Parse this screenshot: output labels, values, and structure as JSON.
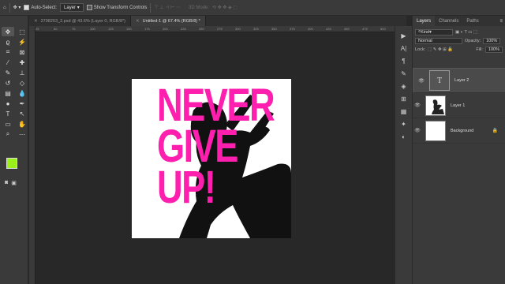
{
  "options_bar": {
    "home_icon": "home-icon",
    "move_icon": "move-icon",
    "auto_select_label": "Auto-Select:",
    "auto_select_value": "Layer",
    "show_transform_label": "Show Transform Controls",
    "threed_mode_label": "3D Mode:"
  },
  "tabs": [
    {
      "label": "2798203_2.psd @ 43.6% (Layer 0, RGB/8*)",
      "active": false
    },
    {
      "label": "Untitled-1 @ 67.4% (RGB/8) *",
      "active": true
    }
  ],
  "ruler_ticks": [
    "25",
    "50",
    "75",
    "100",
    "125",
    "150",
    "175",
    "200",
    "225",
    "250",
    "275",
    "300",
    "325",
    "350",
    "375",
    "400",
    "425",
    "450",
    "475",
    "500"
  ],
  "canvas": {
    "headline_lines": [
      "NEVER",
      "GIVE",
      "UP!"
    ],
    "headline_color": "#ff1fae"
  },
  "colors": {
    "foreground": "#9cf01a",
    "background": "#ffffff"
  },
  "panel": {
    "tabs": [
      "Layers",
      "Channels",
      "Paths"
    ],
    "kind_placeholder": "Kind",
    "blend_mode": "Normal",
    "opacity_label": "Opacity:",
    "opacity_value": "100%",
    "lock_label": "Lock:",
    "fill_label": "Fill:",
    "fill_value": "100%",
    "layers": [
      {
        "name": "Layer 2",
        "type": "text",
        "selected": true
      },
      {
        "name": "Layer 1",
        "type": "image",
        "selected": false
      },
      {
        "name": "Background",
        "type": "fill",
        "selected": false,
        "locked": true
      }
    ]
  }
}
